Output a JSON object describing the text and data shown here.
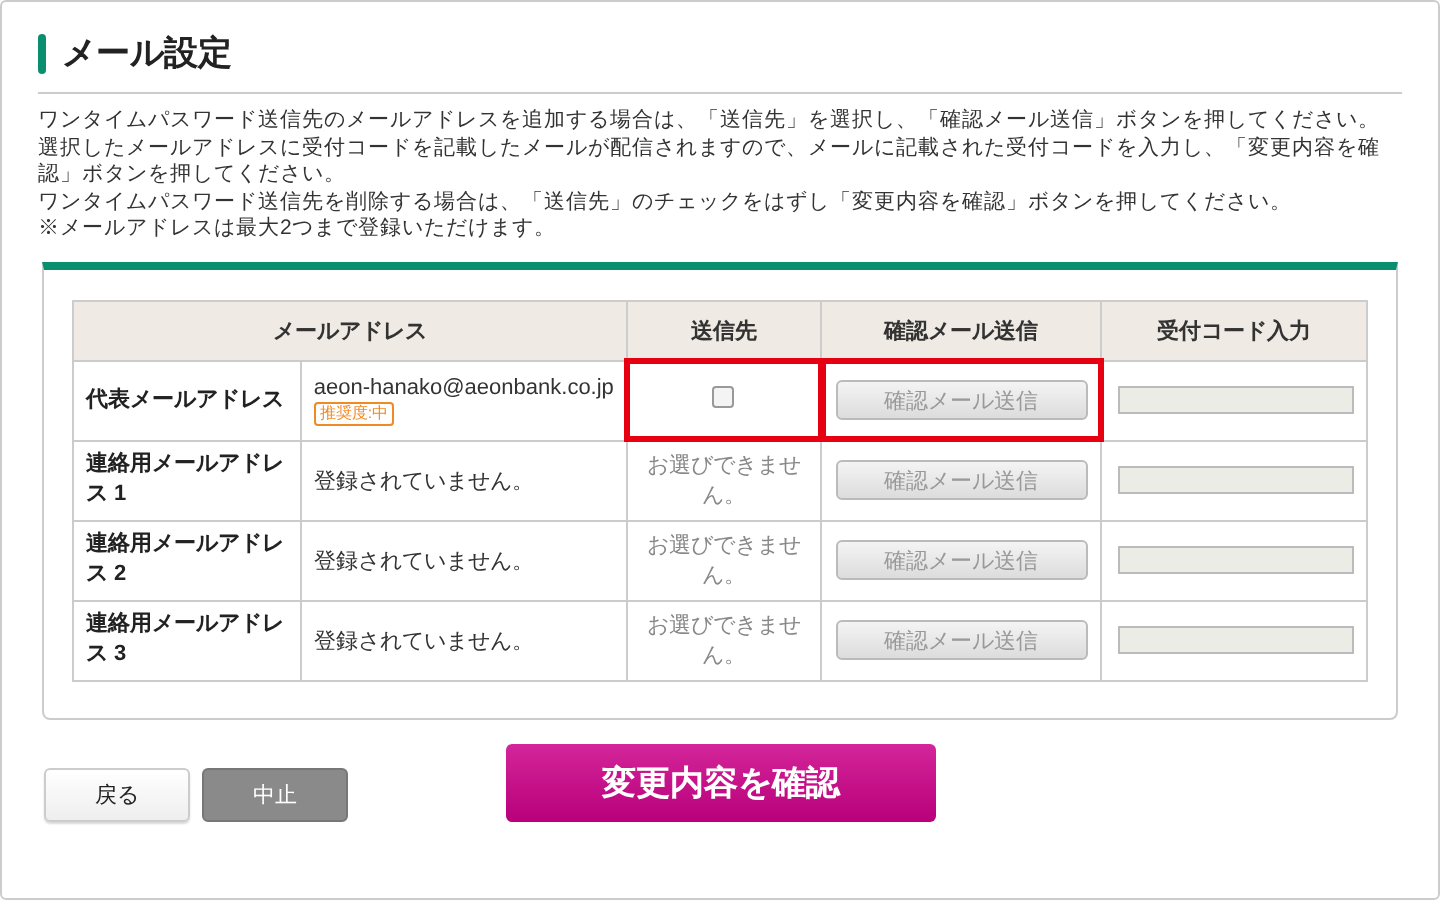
{
  "title": "メール設定",
  "instructions": [
    "ワンタイムパスワード送信先のメールアドレスを追加する場合は、「送信先」を選択し、「確認メール送信」ボタンを押してください。",
    "選択したメールアドレスに受付コードを記載したメールが配信されますので、メールに記載された受付コードを入力し、「変更内容を確認」ボタンを押してください。",
    "ワンタイムパスワード送信先を削除する場合は、「送信先」のチェックをはずし「変更内容を確認」ボタンを押してください。",
    "※メールアドレスは最大2つまで登録いただけます。"
  ],
  "table": {
    "columns": [
      "メールアドレス",
      "送信先",
      "確認メール送信",
      "受付コード入力"
    ],
    "rows": [
      {
        "label": "代表メールアドレス",
        "address": "aeon-hanako@aeonbank.co.jp",
        "badge": "推奨度:中",
        "recipient": {
          "kind": "checkbox",
          "checked": false,
          "highlighted": true
        },
        "confirm_button": {
          "label": "確認メール送信",
          "highlighted": true
        },
        "code_field": {}
      },
      {
        "label": "連絡用メールアドレス 1",
        "address": "登録されていません。",
        "recipient": {
          "kind": "unavailable",
          "text": "お選びできません。",
          "highlighted": false
        },
        "confirm_button": {
          "label": "確認メール送信",
          "highlighted": false
        },
        "code_field": {}
      },
      {
        "label": "連絡用メールアドレス 2",
        "address": "登録されていません。",
        "recipient": {
          "kind": "unavailable",
          "text": "お選びできません。",
          "highlighted": false
        },
        "confirm_button": {
          "label": "確認メール送信",
          "highlighted": false
        },
        "code_field": {}
      },
      {
        "label": "連絡用メールアドレス 3",
        "address": "登録されていません。",
        "recipient": {
          "kind": "unavailable",
          "text": "お選びできません。",
          "highlighted": false
        },
        "confirm_button": {
          "label": "確認メール送信",
          "highlighted": false
        },
        "code_field": {}
      }
    ]
  },
  "buttons": {
    "back": "戻る",
    "cancel": "中止",
    "confirm": "変更内容を確認"
  }
}
